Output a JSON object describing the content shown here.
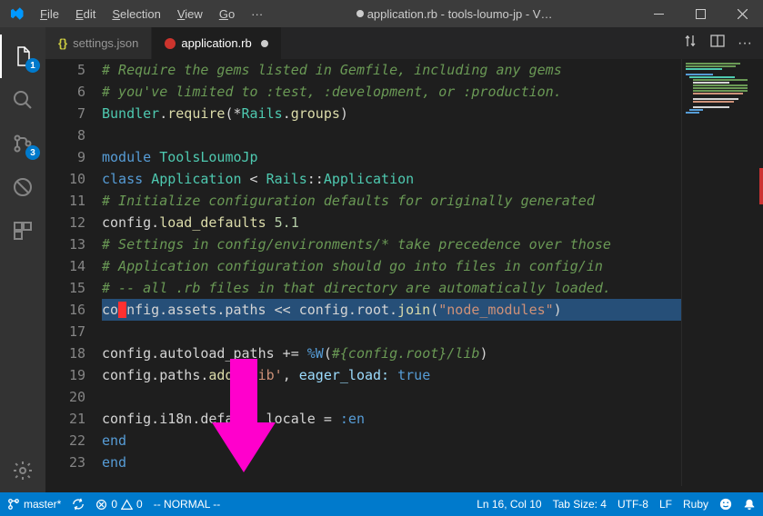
{
  "titlebar": {
    "menus": [
      "File",
      "Edit",
      "Selection",
      "View",
      "Go"
    ],
    "more": "···",
    "title": "application.rb - tools-loumo-jp - V…"
  },
  "activitybar": {
    "explorer_badge": "1",
    "scm_badge": "3"
  },
  "tabs": {
    "settings": "settings.json",
    "application": "application.rb"
  },
  "code": {
    "lines_start": 5,
    "lines": [
      {
        "n": 5,
        "seg": [
          [
            "c-comment",
            "# Require the gems listed in Gemfile, including any gems"
          ]
        ]
      },
      {
        "n": 6,
        "seg": [
          [
            "c-comment",
            "# you've limited to :test, :development, or :production."
          ]
        ]
      },
      {
        "n": 7,
        "seg": [
          [
            "c-const",
            "Bundler"
          ],
          [
            "c-text",
            "."
          ],
          [
            "c-method",
            "require"
          ],
          [
            "c-text",
            "(*"
          ],
          [
            "c-const",
            "Rails"
          ],
          [
            "c-text",
            "."
          ],
          [
            "c-method",
            "groups"
          ],
          [
            "c-text",
            ")"
          ]
        ]
      },
      {
        "n": 8,
        "seg": []
      },
      {
        "n": 9,
        "seg": [
          [
            "c-keyword",
            "module"
          ],
          [
            "c-text",
            " "
          ],
          [
            "c-classname",
            "ToolsLoumoJp"
          ]
        ]
      },
      {
        "n": 10,
        "indent": 1,
        "seg": [
          [
            "c-keyword",
            "class"
          ],
          [
            "c-text",
            " "
          ],
          [
            "c-classname",
            "Application"
          ],
          [
            "c-text",
            " < "
          ],
          [
            "c-const",
            "Rails"
          ],
          [
            "c-text",
            "::"
          ],
          [
            "c-const",
            "Application"
          ]
        ]
      },
      {
        "n": 11,
        "indent": 2,
        "seg": [
          [
            "c-comment",
            "# Initialize configuration defaults for originally generated "
          ]
        ]
      },
      {
        "n": 12,
        "indent": 2,
        "seg": [
          [
            "c-text",
            "config."
          ],
          [
            "c-method",
            "load_defaults"
          ],
          [
            "c-text",
            " "
          ],
          [
            "c-number",
            "5.1"
          ]
        ]
      },
      {
        "n": 13,
        "indent": 2,
        "seg": [
          [
            "c-comment",
            "# Settings in config/environments/* take precedence over those"
          ]
        ]
      },
      {
        "n": 14,
        "indent": 2,
        "seg": [
          [
            "c-comment",
            "# Application configuration should go into files in config/in"
          ]
        ]
      },
      {
        "n": 15,
        "indent": 2,
        "seg": [
          [
            "c-comment",
            "# -- all .rb files in that directory are automatically loaded."
          ]
        ]
      },
      {
        "n": 16,
        "indent": 2,
        "hl": true,
        "cursor": 2,
        "seg": [
          [
            "c-text",
            "config.assets.paths << config.root."
          ],
          [
            "c-method",
            "join"
          ],
          [
            "c-text",
            "("
          ],
          [
            "c-string",
            "\"node_modules\""
          ],
          [
            "c-text",
            ")"
          ]
        ]
      },
      {
        "n": 17,
        "indent": 2,
        "seg": []
      },
      {
        "n": 18,
        "indent": 2,
        "seg": [
          [
            "c-text",
            "config.autoload_paths += "
          ],
          [
            "c-keyword",
            "%W"
          ],
          [
            "c-text",
            "("
          ],
          [
            "c-comment",
            "#{config.root}/lib"
          ],
          [
            "c-text",
            ")"
          ]
        ]
      },
      {
        "n": 19,
        "indent": 2,
        "seg": [
          [
            "c-text",
            "config.paths."
          ],
          [
            "c-method",
            "add"
          ],
          [
            "c-text",
            " "
          ],
          [
            "c-string",
            "'lib'"
          ],
          [
            "c-text",
            ", "
          ],
          [
            "c-var",
            "eager_load:"
          ],
          [
            "c-text",
            " "
          ],
          [
            "c-keyword",
            "true"
          ]
        ]
      },
      {
        "n": 20,
        "indent": 2,
        "seg": []
      },
      {
        "n": 21,
        "indent": 2,
        "seg": [
          [
            "c-text",
            "config.i18n.default_locale = "
          ],
          [
            "c-symbol",
            ":en"
          ]
        ]
      },
      {
        "n": 22,
        "indent": 1,
        "seg": [
          [
            "c-keyword",
            "end"
          ]
        ]
      },
      {
        "n": 23,
        "seg": [
          [
            "c-keyword",
            "end"
          ]
        ]
      }
    ]
  },
  "statusbar": {
    "branch": "master*",
    "errors": "0",
    "warnings": "0",
    "mode": "-- NORMAL --",
    "position": "Ln 16, Col 10",
    "tabsize": "Tab Size: 4",
    "encoding": "UTF-8",
    "eol": "LF",
    "lang": "Ruby"
  }
}
